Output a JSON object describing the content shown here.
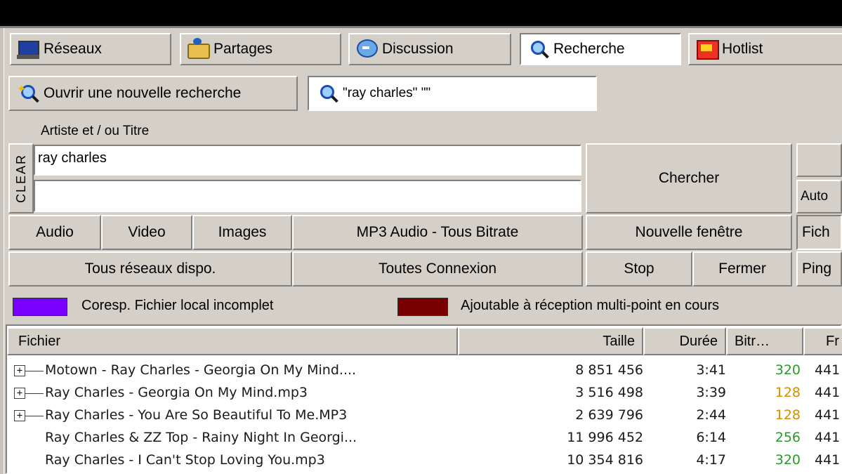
{
  "tabs": [
    {
      "label": "Réseaux",
      "icon": "network-icon"
    },
    {
      "label": "Partages",
      "icon": "share-icon"
    },
    {
      "label": "Discussion",
      "icon": "chat-icon"
    },
    {
      "label": "Recherche",
      "icon": "search-icon"
    },
    {
      "label": "Hotlist",
      "icon": "hotlist-icon"
    }
  ],
  "search": {
    "new_search_label": "Ouvrir une nouvelle recherche",
    "current_query_tab": "\"ray charles\" \"\"",
    "artist_title_label": "Artiste et / ou Titre",
    "clear_label": "CLEAR",
    "query_value": "ray charles",
    "second_value": "",
    "search_button": "Chercher",
    "auto_label": "Auto"
  },
  "filters": {
    "audio": "Audio",
    "video": "Video",
    "images": "Images",
    "format": "MP3 Audio - Tous Bitrate",
    "new_window": "Nouvelle fenêtre",
    "fichier_partial": "Fich",
    "networks": "Tous réseaux dispo.",
    "connections": "Toutes Connexion",
    "stop": "Stop",
    "close": "Fermer",
    "ping_partial": "Ping"
  },
  "legend": {
    "incomplete_label": "Coresp. Fichier local incomplet",
    "incomplete_color": "#7a00ff",
    "multipoint_label": "Ajoutable à réception multi-point en cours",
    "multipoint_color": "#7a0000"
  },
  "table": {
    "columns": {
      "file": "Fichier",
      "size": "Taille",
      "duration": "Durée",
      "bitrate": "Bitr…",
      "freq": "Fr"
    },
    "rows": [
      {
        "file": "Motown - Ray Charles - Georgia On My Mind....",
        "size": "8 851 456",
        "duration": "3:41",
        "bitrate": "320",
        "bitrate_color": "#2a9a2a",
        "freq": "441",
        "expandable": true
      },
      {
        "file": "Ray Charles - Georgia On My Mind.mp3",
        "size": "3 516 498",
        "duration": "3:39",
        "bitrate": "128",
        "bitrate_color": "#d09000",
        "freq": "441",
        "expandable": true
      },
      {
        "file": "Ray Charles - You Are So Beautiful To Me.MP3",
        "size": "2 639 796",
        "duration": "2:44",
        "bitrate": "128",
        "bitrate_color": "#d09000",
        "freq": "441",
        "expandable": true
      },
      {
        "file": "Ray Charles & ZZ Top - Rainy Night In Georgi...",
        "size": "11 996 452",
        "duration": "6:14",
        "bitrate": "256",
        "bitrate_color": "#2a9a2a",
        "freq": "441",
        "expandable": false
      },
      {
        "file": "Ray Charles - I Can't Stop Loving You.mp3",
        "size": "10 354 816",
        "duration": "4:17",
        "bitrate": "320",
        "bitrate_color": "#2a9a2a",
        "freq": "441",
        "expandable": false
      }
    ]
  }
}
